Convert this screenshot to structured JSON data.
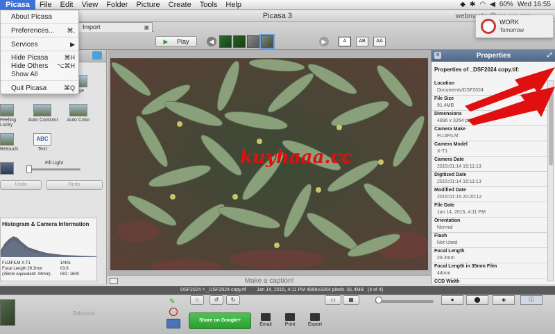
{
  "menubar": {
    "app": "Picasa",
    "items": [
      "File",
      "Edit",
      "View",
      "Folder",
      "Picture",
      "Create",
      "Tools",
      "Help"
    ],
    "battery": "60%",
    "time": "Wed 16:55"
  },
  "window": {
    "title": "Picasa 3",
    "email": "webmaster@mo-ars.org"
  },
  "tabs": {
    "import": "Import"
  },
  "toolbar": {
    "play_label": "Play",
    "layout_buttons": [
      "A",
      "AB",
      "AA"
    ]
  },
  "dropdown": {
    "about": "About Picasa",
    "preferences": "Preferences...",
    "preferences_sc": "⌘,",
    "services": "Services",
    "hide": "Hide Picasa",
    "hide_sc": "⌘H",
    "hide_others": "Hide Others",
    "hide_others_sc": "⌥⌘H",
    "show_all": "Show All",
    "quit": "Quit Picasa",
    "quit_sc": "⌘Q"
  },
  "notification": {
    "title": "WORK",
    "subtitle": "Tomorrow"
  },
  "tools": {
    "labels": [
      "Eye",
      "Feeling Lucky",
      "Auto Contrast",
      "Auto Color",
      "Retouch",
      "Text"
    ],
    "text_icon": "ABC",
    "fill_light": "Fill Light",
    "undo": "Undo",
    "redo": "Redo"
  },
  "histogram": {
    "title": "Histogram & Camera Information",
    "camera_lines": [
      "FUJIFILM X-T1",
      "Focal Length 29.3mm",
      "(35mm equivalent: 44mm)"
    ],
    "camera_values": [
      "1/40s",
      "f/3.6",
      "ISO: 1600"
    ]
  },
  "watermark": "kuyhaaa.cc",
  "caption": "Make a caption!",
  "properties": {
    "title": "Properties",
    "of_label": "Properties of _DSF2024 copy.tif:",
    "rows": [
      {
        "label": "Location",
        "value": "Documents/DSF2024"
      },
      {
        "label": "File Size",
        "value": "91.4MB"
      },
      {
        "label": "Dimensions",
        "value": "4896 x 3264 pixels"
      },
      {
        "label": "Camera Make",
        "value": "FUJIFILM"
      },
      {
        "label": "Camera Model",
        "value": "X-T1"
      },
      {
        "label": "Camera Date",
        "value": "2015:01:14 16:11:13"
      },
      {
        "label": "Digitized Date",
        "value": "2015:01:14 16:11:13"
      },
      {
        "label": "Modified Date",
        "value": "2015:01:15 20:20:12"
      },
      {
        "label": "File Date",
        "value": "Jan 14, 2015, 4:11 PM"
      },
      {
        "label": "Orientation",
        "value": "Normal"
      },
      {
        "label": "Flash",
        "value": "Not Used"
      },
      {
        "label": "Focal Length",
        "value": "29.3mm"
      },
      {
        "label": "Focal Length in 35mm Film",
        "value": "44mm"
      },
      {
        "label": "CCD Width",
        "value": ""
      }
    ]
  },
  "status": {
    "path": "DSF2024 > _DSF2024 copy.tif",
    "date": "Jan 14, 2015, 4:11 PM",
    "pixels": "4896x3264 pixels",
    "size": "91.4MB",
    "count": "(4 of 4)"
  },
  "tray": {
    "selection": "Selection",
    "share": "Share on Google+",
    "email": "Email",
    "print": "Print",
    "export": "Export"
  },
  "colors": {
    "accent": "#3d73d9",
    "share_green": "#35a838",
    "arrow_red": "#e01010"
  }
}
